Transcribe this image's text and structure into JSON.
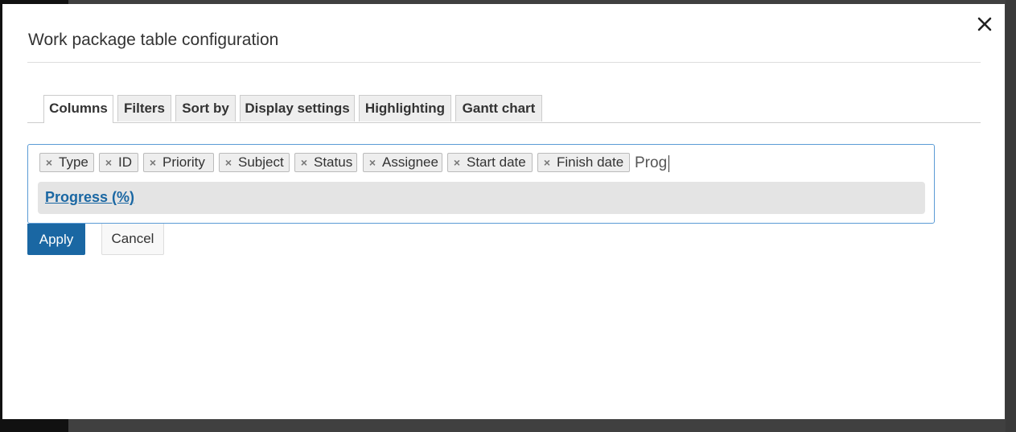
{
  "modal": {
    "title": "Work package table configuration",
    "close_icon": "close-icon"
  },
  "tabs": [
    {
      "label": "Columns",
      "active": true
    },
    {
      "label": "Filters",
      "active": false
    },
    {
      "label": "Sort by",
      "active": false
    },
    {
      "label": "Display settings",
      "active": false
    },
    {
      "label": "Highlighting",
      "active": false
    },
    {
      "label": "Gantt chart",
      "active": false
    }
  ],
  "columns": {
    "selected": [
      {
        "label": "Type",
        "remove_icon": "remove-icon"
      },
      {
        "label": "ID",
        "remove_icon": "remove-icon"
      },
      {
        "label": "Priority",
        "remove_icon": "remove-icon"
      },
      {
        "label": "Subject",
        "remove_icon": "remove-icon"
      },
      {
        "label": "Status",
        "remove_icon": "remove-icon"
      },
      {
        "label": "Assignee",
        "remove_icon": "remove-icon"
      },
      {
        "label": "Start date",
        "remove_icon": "remove-icon"
      },
      {
        "label": "Finish date",
        "remove_icon": "remove-icon"
      }
    ],
    "search_value": "Prog",
    "dropdown_options": [
      {
        "label": "Progress (%)"
      }
    ]
  },
  "actions": {
    "apply_label": "Apply",
    "cancel_label": "Cancel"
  },
  "colors": {
    "accent": "#1a67a3",
    "focus_border": "#5b9bd5",
    "chip_bg": "#eeeeee",
    "option_highlight": "#e4e4e4"
  }
}
